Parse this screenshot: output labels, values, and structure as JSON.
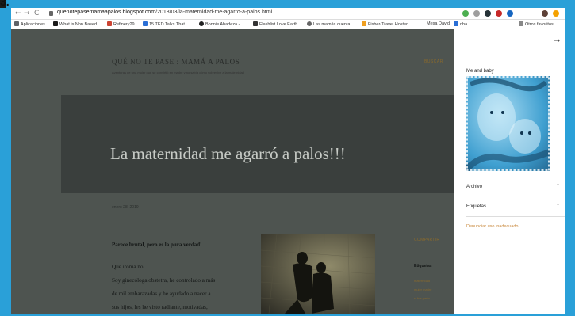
{
  "image_label": "3.",
  "browser": {
    "url_host": "quenotepasemamaapalos.blogspot.com",
    "url_path": "/2018/03/la-maternidad-me-agarro-a-palos.html",
    "nav": {
      "back": "←",
      "forward": "→",
      "reload": "C"
    },
    "bookmarks": [
      {
        "label": "Aplicaciones",
        "color": "#5f6368"
      },
      {
        "label": "What is Non Based...",
        "color": "#1a1a1a"
      },
      {
        "label": "Refinery29",
        "color": "#c43"
      },
      {
        "label": "15 TED Talks That...",
        "color": "#2a6fd6"
      },
      {
        "label": "Bonnie Abadeza -...",
        "color": "#222"
      },
      {
        "label": "Flashlist.Love Earth...",
        "color": "#333"
      },
      {
        "label": "Las mamás cuenta...",
        "color": "#666"
      },
      {
        "label": "Fisher-Travel Hoster...",
        "color": "#f0a020"
      },
      {
        "label": "Mesa David",
        "color": "#888"
      },
      {
        "label": "nba",
        "color": "#2a6fd6"
      },
      {
        "label": "Otros favoritos",
        "color": "#888"
      }
    ]
  },
  "blog": {
    "title": "QUÉ NO TE PASE : MAMÁ A PALOS",
    "description": "Aventuras de una mujer que se convirtió en madre y no sabía cómo sobrevivir a la maternidad",
    "search_label": "BUSCAR",
    "hero_title": "La maternidad me agarró a palos!!!",
    "post_date": "enero 28, 2019",
    "post_lead": "Parece brutal, pero es la pura verdad!",
    "post_lines": [
      "Que ironía no.",
      "Soy ginecóloga obstetra, he controlado a más",
      "de mil embarazadas y he ayudado a nacer a",
      "sus hijos, les he visto radiante, motivadas,"
    ],
    "share_label": "COMPARTIR",
    "labels_heading": "Etiquetas",
    "labels": [
      "maternidad",
      "mujer madre",
      "si fue parto"
    ]
  },
  "sidebar": {
    "close": "→",
    "image_heading": "Me and baby",
    "archive_label": "Archivo",
    "labels_label": "Etiquetas",
    "chevron": "⌄",
    "report_label": "Denunciar uso inadecuado"
  }
}
